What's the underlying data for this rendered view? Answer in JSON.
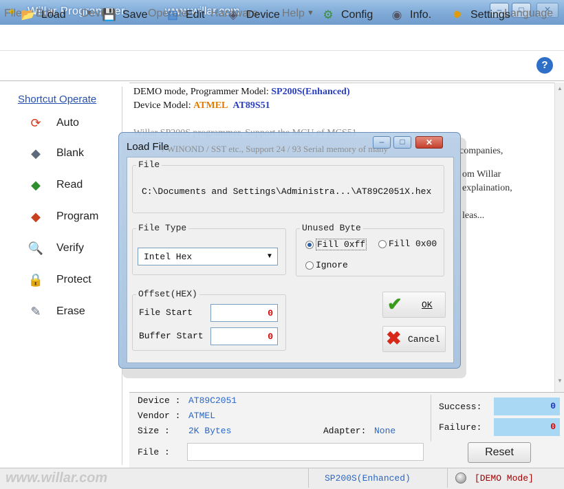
{
  "window": {
    "title": "Willar Programmer",
    "url": "www.willar.com",
    "controls": {
      "minimize": "–",
      "maximize": "□",
      "close": "✕"
    }
  },
  "menu": [
    "File",
    "Edit",
    "Device",
    "Operate",
    "Hardware",
    "Help",
    "Language"
  ],
  "toolbar": {
    "load": "Load",
    "save": "Save",
    "edit": "Edit",
    "device": "Device",
    "config": "Config",
    "info": "Info.",
    "settings": "Settings",
    "help_icon": "?"
  },
  "sidebar": {
    "title": "Shortcut Operate",
    "items": [
      "Auto",
      "Blank",
      "Read",
      "Program",
      "Verify",
      "Protect",
      "Erase"
    ]
  },
  "main": {
    "line1_prefix": "DEMO mode, Programmer Model: ",
    "programmer_model": "SP200S(Enhanced)",
    "line2_prefix": "Device Model: ",
    "device_maker": "ATMEL",
    "device_model": "AT89S51",
    "bg_line1": "Willar SP200S programmer, Support the MCU of MCS51",
    "bg_line2": "companies,",
    "bg_line3": "om Willar",
    "bg_line4": "explaination,",
    "bg_line5": "leas..."
  },
  "dialog": {
    "title": "Load File",
    "title_overlap_text": "/ WINOND / SST etc., Support 24 / 93 Serial memory of many",
    "file_label": "File",
    "file_path": "C:\\Documents and Settings\\Administra...\\AT89C2051X.hex",
    "file_type_label": "File Type",
    "file_type_value": "Intel Hex",
    "unused_byte_label": "Unused Byte",
    "fill_ff": "Fill 0xff",
    "fill_00": "Fill 0x00",
    "ignore": "Ignore",
    "offset_label": "Offset(HEX)",
    "file_start_label": "File Start",
    "file_start_value": "0",
    "buffer_start_label": "Buffer Start",
    "buffer_start_value": "0",
    "ok": "OK",
    "cancel": "Cancel"
  },
  "info": {
    "device_label": "Device  :",
    "device_value": "AT89C2051",
    "vendor_label": "Vendor  :",
    "vendor_value": "ATMEL",
    "size_label": "Size    :",
    "size_value": "2K Bytes",
    "adapter_label": "Adapter:",
    "adapter_value": "None",
    "file_label": "File    :",
    "success_label": "Success:",
    "success_value": "0",
    "failure_label": "Failure:",
    "failure_value": "0",
    "reset": "Reset"
  },
  "status": {
    "watermark": "www.willar.com",
    "programmer": "SP200S(Enhanced)",
    "mode": "[DEMO Mode]"
  },
  "colors": {
    "accent_blue": "#2a66c7",
    "model_orange": "#e07a00",
    "failure_red": "#d80000",
    "counter_bg": "#a9d8f5"
  }
}
